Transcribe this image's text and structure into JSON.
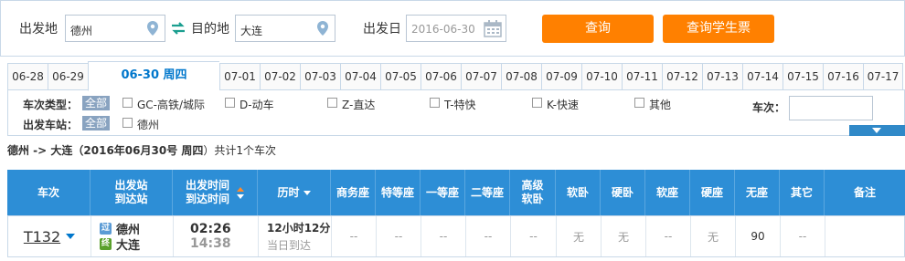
{
  "search": {
    "from_label": "出发地",
    "from_value": "德州",
    "to_label": "目的地",
    "to_value": "大连",
    "date_label": "出发日",
    "date_value": "2016-06-30",
    "query_button": "查询",
    "student_button": "查询学生票"
  },
  "tabs": [
    "06-28",
    "06-29",
    "06-30 周四",
    "07-01",
    "07-02",
    "07-03",
    "07-04",
    "07-05",
    "07-06",
    "07-07",
    "07-08",
    "07-09",
    "07-10",
    "07-11",
    "07-12",
    "07-13",
    "07-14",
    "07-15",
    "07-16",
    "07-17"
  ],
  "active_tab": 2,
  "filter": {
    "type_label": "车次类型：",
    "all_label": "全部",
    "types": [
      "GC-高铁/城际",
      "D-动车",
      "Z-直达",
      "T-特快",
      "K-快速",
      "其他"
    ],
    "station_label": "出发车站：",
    "station_all": "全部",
    "stations": [
      "德州"
    ],
    "train_no_label": "车次："
  },
  "summary": {
    "route": "德州 -> 大连（",
    "date": "2016年06月30号  周四",
    "suffix": "）共计1个车次"
  },
  "table": {
    "headers": {
      "train": "车次",
      "station1": "出发站",
      "station2": "到达站",
      "time1": "出发时间",
      "time2": "到达时间",
      "duration": "历时",
      "business": "商务座",
      "premium": "特等座",
      "first": "一等座",
      "second": "二等座",
      "high_soft1": "高级",
      "high_soft2": "软卧",
      "soft_sleeper": "软卧",
      "hard_sleeper": "硬卧",
      "soft_seat": "软座",
      "hard_seat": "硬座",
      "no_seat": "无座",
      "other": "其它",
      "remark": "备注"
    },
    "rows": [
      {
        "train": "T132",
        "from_badge": "过",
        "from": "德州",
        "to_badge": "终",
        "to": "大连",
        "depart": "02:26",
        "arrive": "14:38",
        "duration": "12小时12分",
        "arrival_day": "当日到达",
        "business": "--",
        "premium": "--",
        "first": "--",
        "second": "--",
        "high_soft": "--",
        "soft_sleeper": "无",
        "hard_sleeper": "无",
        "soft_seat": "--",
        "hard_seat": "无",
        "no_seat": "90",
        "other": "--",
        "remark": ""
      }
    ]
  },
  "colors": {
    "accent_orange": "#ff8000",
    "header_blue": "#2d8ed6",
    "link_blue": "#0077cc",
    "badge_pass": "#5b9bd5",
    "badge_end": "#5aa02c"
  },
  "icons": {
    "location": "location-pin-icon",
    "swap": "swap-arrows-icon",
    "calendar": "calendar-icon",
    "sort": "sort-caret-icon",
    "expand": "chevron-down-icon"
  }
}
